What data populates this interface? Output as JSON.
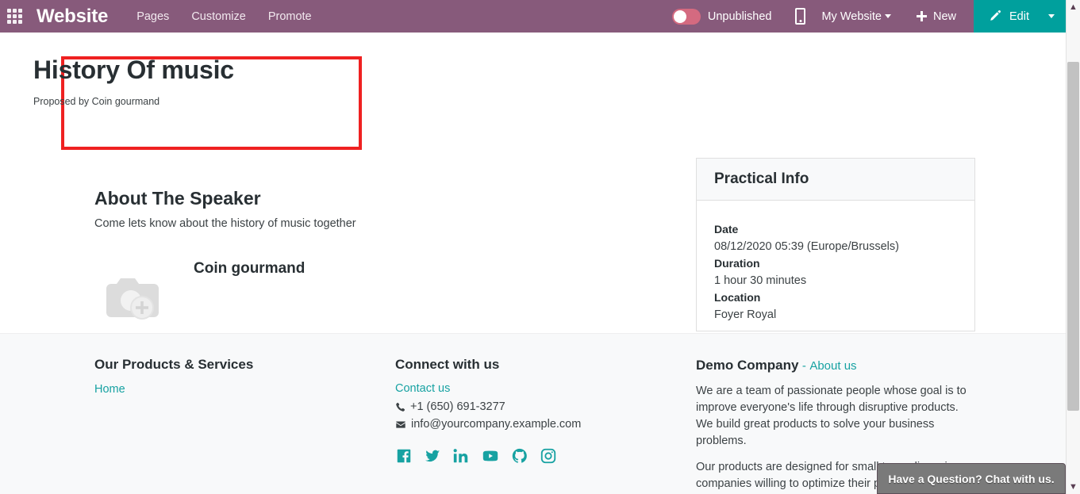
{
  "navbar": {
    "apps_icon": "apps-grid-icon",
    "brand": "Website",
    "links": [
      {
        "label": "Pages"
      },
      {
        "label": "Customize"
      },
      {
        "label": "Promote"
      }
    ],
    "publish_state": "Unpublished",
    "toggle_state": "off",
    "mobile_preview_icon": "mobile-phone-icon",
    "site_selector": "My Website",
    "new_button": "New",
    "edit_button": "Edit",
    "accent_purple": "#875A7B",
    "accent_teal": "#00A09D",
    "toggle_color": "#D46A80"
  },
  "hero": {
    "title": "History Of music",
    "subtitle": "Proposed by Coin gourmand",
    "highlight_color": "#EF2121"
  },
  "about": {
    "heading": "About The Speaker",
    "description": "Come lets know about the history of music together",
    "speaker_name": "Coin gourmand",
    "photo_placeholder_icon": "camera-add-photo-icon"
  },
  "practical_info": {
    "title": "Practical Info",
    "fields": [
      {
        "label": "Date",
        "value": "08/12/2020 05:39 (Europe/Brussels)"
      },
      {
        "label": "Duration",
        "value": "1 hour 30 minutes"
      },
      {
        "label": "Location",
        "value": "Foyer Royal"
      }
    ]
  },
  "footer": {
    "products": {
      "heading": "Our Products & Services",
      "links": [
        {
          "label": "Home"
        }
      ]
    },
    "connect": {
      "heading": "Connect with us",
      "contact_link": "Contact us",
      "phone": "+1 (650) 691-3277",
      "email": "info@yourcompany.example.com",
      "socials": [
        {
          "name": "facebook-icon"
        },
        {
          "name": "twitter-icon"
        },
        {
          "name": "linkedin-icon"
        },
        {
          "name": "youtube-icon"
        },
        {
          "name": "github-icon"
        },
        {
          "name": "instagram-icon"
        }
      ],
      "link_color": "#17A2A2"
    },
    "company": {
      "name": "Demo Company",
      "separator": "-",
      "about_link": "About us",
      "paragraph1": "We are a team of passionate people whose goal is to improve everyone's life through disruptive products. We build great products to solve your business problems.",
      "paragraph2": "Our products are designed for small to medium size companies willing to optimize their performance."
    }
  },
  "chat_widget": {
    "label": "Have a Question? Chat with us."
  },
  "scrollbar": {
    "up_arrow": "chevron-up-icon",
    "down_arrow": "chevron-down-icon"
  }
}
